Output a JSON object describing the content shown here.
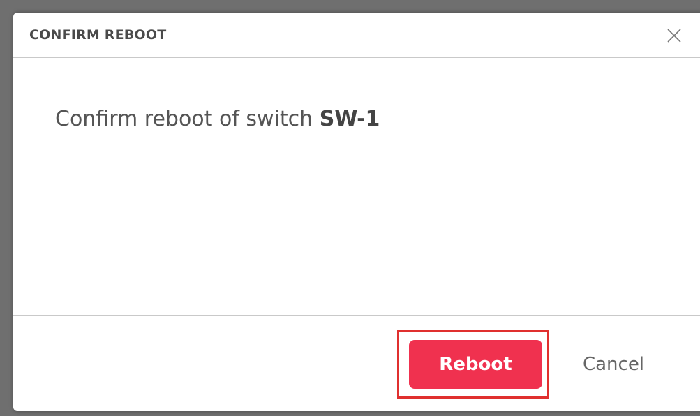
{
  "dialog": {
    "title": "CONFIRM REBOOT",
    "close_icon": "close-icon",
    "message_prefix": "Confirm reboot of switch ",
    "switch_name": "SW-1",
    "buttons": {
      "primary_label": "Reboot",
      "secondary_label": "Cancel"
    }
  },
  "colors": {
    "primary_button": "#f0314f",
    "highlight_border": "#e0302f",
    "backdrop": "#6f6f6f"
  }
}
